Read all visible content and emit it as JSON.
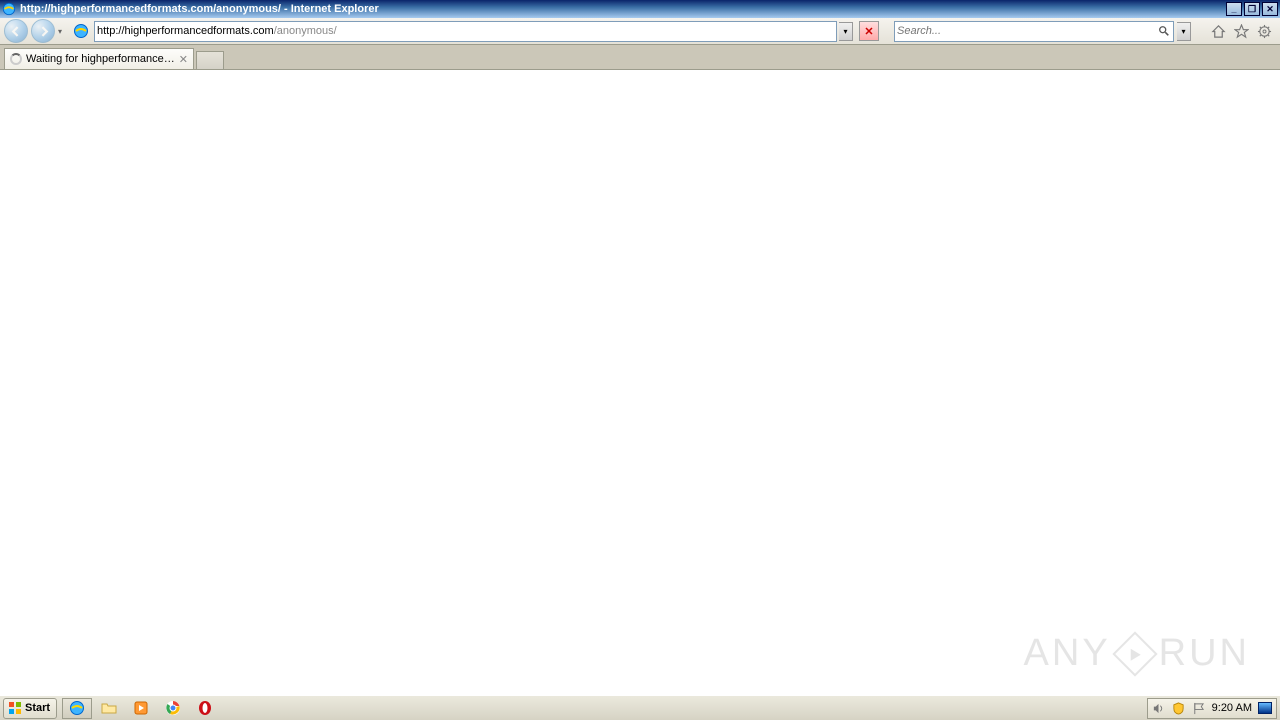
{
  "window": {
    "title": "http://highperformancedformats.com/anonymous/ - Internet Explorer"
  },
  "nav": {
    "url_main": "http://highperformancedformats.com",
    "url_path": "/anonymous/",
    "search_placeholder": "Search..."
  },
  "tabs": {
    "active": "Waiting for highperformance…"
  },
  "watermark": {
    "left": "ANY",
    "right": "RUN"
  },
  "taskbar": {
    "start": "Start",
    "clock": "9:20 AM"
  }
}
